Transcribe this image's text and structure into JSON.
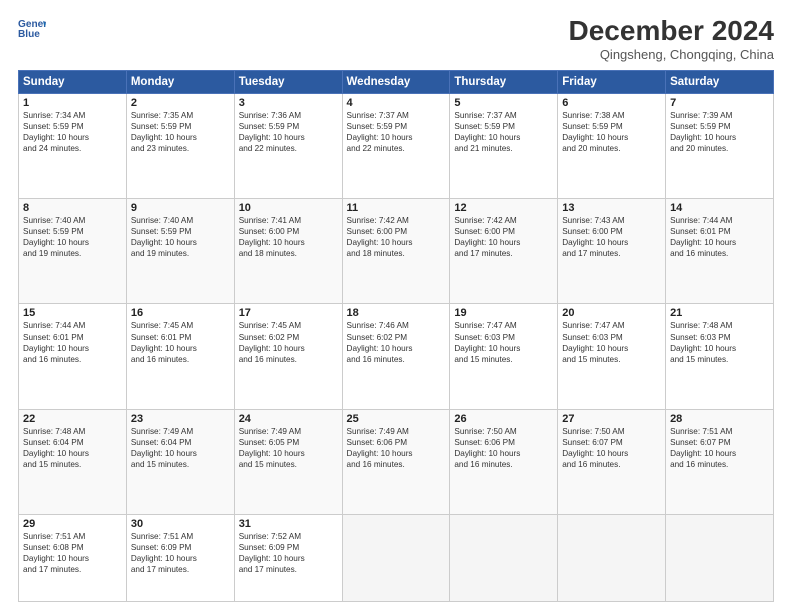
{
  "header": {
    "logo_line1": "General",
    "logo_line2": "Blue",
    "month": "December 2024",
    "location": "Qingsheng, Chongqing, China"
  },
  "weekdays": [
    "Sunday",
    "Monday",
    "Tuesday",
    "Wednesday",
    "Thursday",
    "Friday",
    "Saturday"
  ],
  "weeks": [
    [
      {
        "day": "1",
        "info": "Sunrise: 7:34 AM\nSunset: 5:59 PM\nDaylight: 10 hours\nand 24 minutes."
      },
      {
        "day": "2",
        "info": "Sunrise: 7:35 AM\nSunset: 5:59 PM\nDaylight: 10 hours\nand 23 minutes."
      },
      {
        "day": "3",
        "info": "Sunrise: 7:36 AM\nSunset: 5:59 PM\nDaylight: 10 hours\nand 22 minutes."
      },
      {
        "day": "4",
        "info": "Sunrise: 7:37 AM\nSunset: 5:59 PM\nDaylight: 10 hours\nand 22 minutes."
      },
      {
        "day": "5",
        "info": "Sunrise: 7:37 AM\nSunset: 5:59 PM\nDaylight: 10 hours\nand 21 minutes."
      },
      {
        "day": "6",
        "info": "Sunrise: 7:38 AM\nSunset: 5:59 PM\nDaylight: 10 hours\nand 20 minutes."
      },
      {
        "day": "7",
        "info": "Sunrise: 7:39 AM\nSunset: 5:59 PM\nDaylight: 10 hours\nand 20 minutes."
      }
    ],
    [
      {
        "day": "8",
        "info": "Sunrise: 7:40 AM\nSunset: 5:59 PM\nDaylight: 10 hours\nand 19 minutes."
      },
      {
        "day": "9",
        "info": "Sunrise: 7:40 AM\nSunset: 5:59 PM\nDaylight: 10 hours\nand 19 minutes."
      },
      {
        "day": "10",
        "info": "Sunrise: 7:41 AM\nSunset: 6:00 PM\nDaylight: 10 hours\nand 18 minutes."
      },
      {
        "day": "11",
        "info": "Sunrise: 7:42 AM\nSunset: 6:00 PM\nDaylight: 10 hours\nand 18 minutes."
      },
      {
        "day": "12",
        "info": "Sunrise: 7:42 AM\nSunset: 6:00 PM\nDaylight: 10 hours\nand 17 minutes."
      },
      {
        "day": "13",
        "info": "Sunrise: 7:43 AM\nSunset: 6:00 PM\nDaylight: 10 hours\nand 17 minutes."
      },
      {
        "day": "14",
        "info": "Sunrise: 7:44 AM\nSunset: 6:01 PM\nDaylight: 10 hours\nand 16 minutes."
      }
    ],
    [
      {
        "day": "15",
        "info": "Sunrise: 7:44 AM\nSunset: 6:01 PM\nDaylight: 10 hours\nand 16 minutes."
      },
      {
        "day": "16",
        "info": "Sunrise: 7:45 AM\nSunset: 6:01 PM\nDaylight: 10 hours\nand 16 minutes."
      },
      {
        "day": "17",
        "info": "Sunrise: 7:45 AM\nSunset: 6:02 PM\nDaylight: 10 hours\nand 16 minutes."
      },
      {
        "day": "18",
        "info": "Sunrise: 7:46 AM\nSunset: 6:02 PM\nDaylight: 10 hours\nand 16 minutes."
      },
      {
        "day": "19",
        "info": "Sunrise: 7:47 AM\nSunset: 6:03 PM\nDaylight: 10 hours\nand 15 minutes."
      },
      {
        "day": "20",
        "info": "Sunrise: 7:47 AM\nSunset: 6:03 PM\nDaylight: 10 hours\nand 15 minutes."
      },
      {
        "day": "21",
        "info": "Sunrise: 7:48 AM\nSunset: 6:03 PM\nDaylight: 10 hours\nand 15 minutes."
      }
    ],
    [
      {
        "day": "22",
        "info": "Sunrise: 7:48 AM\nSunset: 6:04 PM\nDaylight: 10 hours\nand 15 minutes."
      },
      {
        "day": "23",
        "info": "Sunrise: 7:49 AM\nSunset: 6:04 PM\nDaylight: 10 hours\nand 15 minutes."
      },
      {
        "day": "24",
        "info": "Sunrise: 7:49 AM\nSunset: 6:05 PM\nDaylight: 10 hours\nand 15 minutes."
      },
      {
        "day": "25",
        "info": "Sunrise: 7:49 AM\nSunset: 6:06 PM\nDaylight: 10 hours\nand 16 minutes."
      },
      {
        "day": "26",
        "info": "Sunrise: 7:50 AM\nSunset: 6:06 PM\nDaylight: 10 hours\nand 16 minutes."
      },
      {
        "day": "27",
        "info": "Sunrise: 7:50 AM\nSunset: 6:07 PM\nDaylight: 10 hours\nand 16 minutes."
      },
      {
        "day": "28",
        "info": "Sunrise: 7:51 AM\nSunset: 6:07 PM\nDaylight: 10 hours\nand 16 minutes."
      }
    ],
    [
      {
        "day": "29",
        "info": "Sunrise: 7:51 AM\nSunset: 6:08 PM\nDaylight: 10 hours\nand 17 minutes."
      },
      {
        "day": "30",
        "info": "Sunrise: 7:51 AM\nSunset: 6:09 PM\nDaylight: 10 hours\nand 17 minutes."
      },
      {
        "day": "31",
        "info": "Sunrise: 7:52 AM\nSunset: 6:09 PM\nDaylight: 10 hours\nand 17 minutes."
      },
      {
        "day": "",
        "info": ""
      },
      {
        "day": "",
        "info": ""
      },
      {
        "day": "",
        "info": ""
      },
      {
        "day": "",
        "info": ""
      }
    ]
  ]
}
